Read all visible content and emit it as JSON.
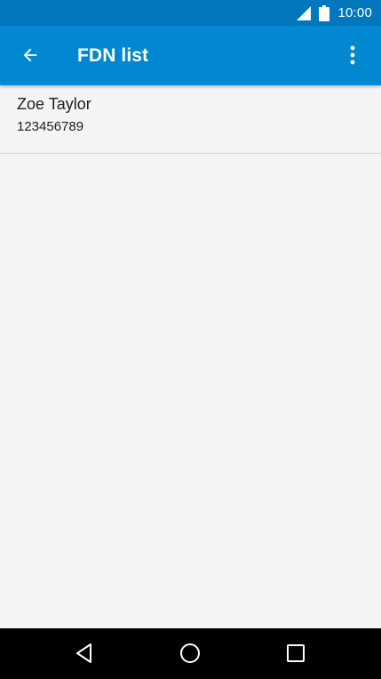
{
  "status_bar": {
    "time": "10:00",
    "icons": [
      "cell-signal-icon",
      "battery-icon"
    ]
  },
  "app_bar": {
    "title": "FDN list",
    "back_icon": "arrow-back-icon",
    "menu_icon": "more-vert-icon"
  },
  "fdn_list": [
    {
      "name": "Zoe Taylor",
      "number": "123456789"
    }
  ],
  "nav_bar": {
    "icons": [
      "back-triangle-icon",
      "home-circle-icon",
      "recents-square-icon"
    ]
  },
  "colors": {
    "status_bar": "#0277bd",
    "app_bar": "#0288d1",
    "background": "#f4f4f4",
    "text": "#212121",
    "nav_bar": "#000000"
  }
}
